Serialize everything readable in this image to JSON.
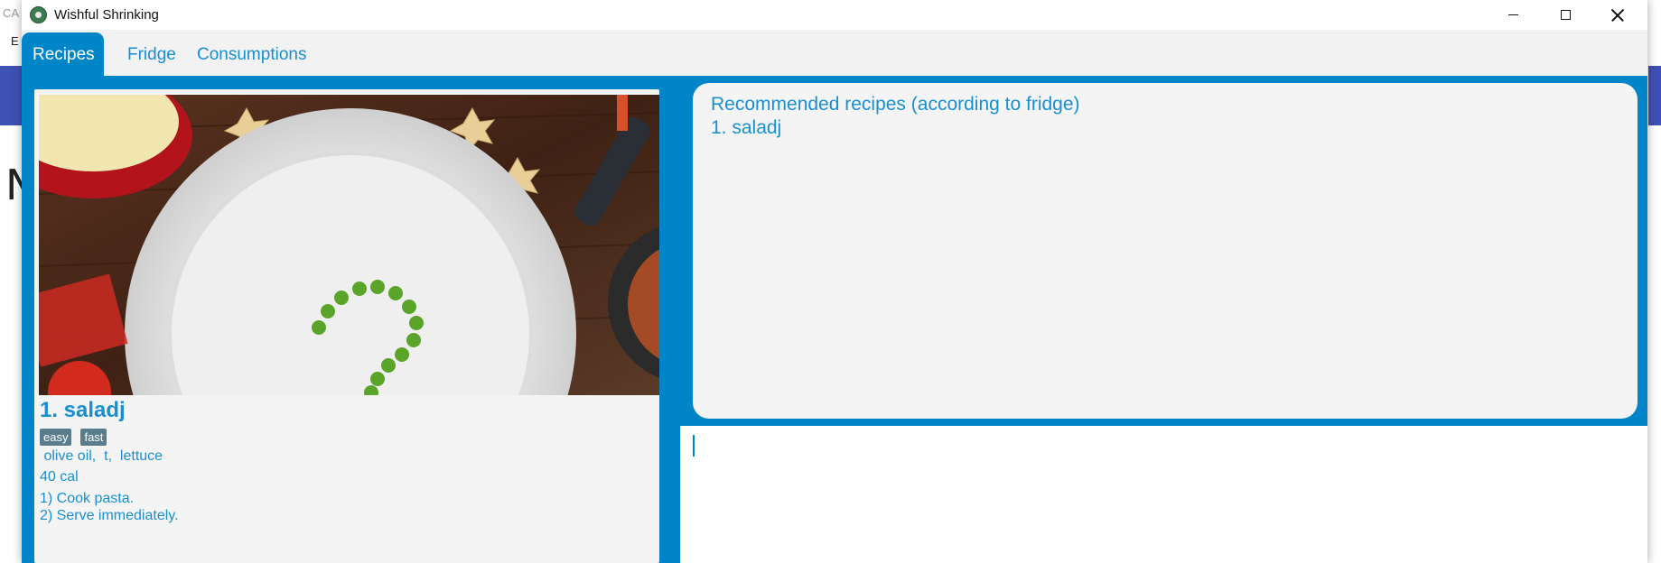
{
  "background_app": {
    "top_text": "CA",
    "menu_letter": "E",
    "big_letter": "N",
    "banner_color": "#3f51b5"
  },
  "window": {
    "title": "Wishful Shrinking",
    "accent_color": "#0085c9"
  },
  "tabs": [
    {
      "label": "Recipes",
      "active": true
    },
    {
      "label": "Fridge",
      "active": false
    },
    {
      "label": "Consumptions",
      "active": false
    }
  ],
  "recipe": {
    "title": "1.  saladj",
    "tags": [
      "easy",
      "fast"
    ],
    "ingredients": " olive oil,  t,  lettuce",
    "calories": "40 cal",
    "steps": [
      "1) Cook pasta.",
      "2) Serve immediately."
    ],
    "image": "plate-with-peas-photo"
  },
  "recommendations": {
    "title": "Recommended recipes (according to fridge)",
    "items": [
      "1. saladj"
    ]
  },
  "command_box": {
    "value": ""
  }
}
